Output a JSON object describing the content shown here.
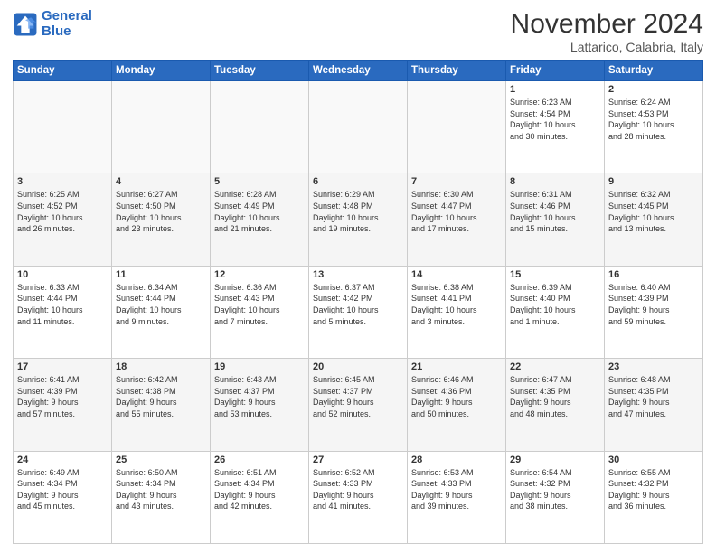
{
  "logo": {
    "line1": "General",
    "line2": "Blue"
  },
  "title": "November 2024",
  "location": "Lattarico, Calabria, Italy",
  "days_header": [
    "Sunday",
    "Monday",
    "Tuesday",
    "Wednesday",
    "Thursday",
    "Friday",
    "Saturday"
  ],
  "weeks": [
    [
      {
        "num": "",
        "info": ""
      },
      {
        "num": "",
        "info": ""
      },
      {
        "num": "",
        "info": ""
      },
      {
        "num": "",
        "info": ""
      },
      {
        "num": "",
        "info": ""
      },
      {
        "num": "1",
        "info": "Sunrise: 6:23 AM\nSunset: 4:54 PM\nDaylight: 10 hours\nand 30 minutes."
      },
      {
        "num": "2",
        "info": "Sunrise: 6:24 AM\nSunset: 4:53 PM\nDaylight: 10 hours\nand 28 minutes."
      }
    ],
    [
      {
        "num": "3",
        "info": "Sunrise: 6:25 AM\nSunset: 4:52 PM\nDaylight: 10 hours\nand 26 minutes."
      },
      {
        "num": "4",
        "info": "Sunrise: 6:27 AM\nSunset: 4:50 PM\nDaylight: 10 hours\nand 23 minutes."
      },
      {
        "num": "5",
        "info": "Sunrise: 6:28 AM\nSunset: 4:49 PM\nDaylight: 10 hours\nand 21 minutes."
      },
      {
        "num": "6",
        "info": "Sunrise: 6:29 AM\nSunset: 4:48 PM\nDaylight: 10 hours\nand 19 minutes."
      },
      {
        "num": "7",
        "info": "Sunrise: 6:30 AM\nSunset: 4:47 PM\nDaylight: 10 hours\nand 17 minutes."
      },
      {
        "num": "8",
        "info": "Sunrise: 6:31 AM\nSunset: 4:46 PM\nDaylight: 10 hours\nand 15 minutes."
      },
      {
        "num": "9",
        "info": "Sunrise: 6:32 AM\nSunset: 4:45 PM\nDaylight: 10 hours\nand 13 minutes."
      }
    ],
    [
      {
        "num": "10",
        "info": "Sunrise: 6:33 AM\nSunset: 4:44 PM\nDaylight: 10 hours\nand 11 minutes."
      },
      {
        "num": "11",
        "info": "Sunrise: 6:34 AM\nSunset: 4:44 PM\nDaylight: 10 hours\nand 9 minutes."
      },
      {
        "num": "12",
        "info": "Sunrise: 6:36 AM\nSunset: 4:43 PM\nDaylight: 10 hours\nand 7 minutes."
      },
      {
        "num": "13",
        "info": "Sunrise: 6:37 AM\nSunset: 4:42 PM\nDaylight: 10 hours\nand 5 minutes."
      },
      {
        "num": "14",
        "info": "Sunrise: 6:38 AM\nSunset: 4:41 PM\nDaylight: 10 hours\nand 3 minutes."
      },
      {
        "num": "15",
        "info": "Sunrise: 6:39 AM\nSunset: 4:40 PM\nDaylight: 10 hours\nand 1 minute."
      },
      {
        "num": "16",
        "info": "Sunrise: 6:40 AM\nSunset: 4:39 PM\nDaylight: 9 hours\nand 59 minutes."
      }
    ],
    [
      {
        "num": "17",
        "info": "Sunrise: 6:41 AM\nSunset: 4:39 PM\nDaylight: 9 hours\nand 57 minutes."
      },
      {
        "num": "18",
        "info": "Sunrise: 6:42 AM\nSunset: 4:38 PM\nDaylight: 9 hours\nand 55 minutes."
      },
      {
        "num": "19",
        "info": "Sunrise: 6:43 AM\nSunset: 4:37 PM\nDaylight: 9 hours\nand 53 minutes."
      },
      {
        "num": "20",
        "info": "Sunrise: 6:45 AM\nSunset: 4:37 PM\nDaylight: 9 hours\nand 52 minutes."
      },
      {
        "num": "21",
        "info": "Sunrise: 6:46 AM\nSunset: 4:36 PM\nDaylight: 9 hours\nand 50 minutes."
      },
      {
        "num": "22",
        "info": "Sunrise: 6:47 AM\nSunset: 4:35 PM\nDaylight: 9 hours\nand 48 minutes."
      },
      {
        "num": "23",
        "info": "Sunrise: 6:48 AM\nSunset: 4:35 PM\nDaylight: 9 hours\nand 47 minutes."
      }
    ],
    [
      {
        "num": "24",
        "info": "Sunrise: 6:49 AM\nSunset: 4:34 PM\nDaylight: 9 hours\nand 45 minutes."
      },
      {
        "num": "25",
        "info": "Sunrise: 6:50 AM\nSunset: 4:34 PM\nDaylight: 9 hours\nand 43 minutes."
      },
      {
        "num": "26",
        "info": "Sunrise: 6:51 AM\nSunset: 4:34 PM\nDaylight: 9 hours\nand 42 minutes."
      },
      {
        "num": "27",
        "info": "Sunrise: 6:52 AM\nSunset: 4:33 PM\nDaylight: 9 hours\nand 41 minutes."
      },
      {
        "num": "28",
        "info": "Sunrise: 6:53 AM\nSunset: 4:33 PM\nDaylight: 9 hours\nand 39 minutes."
      },
      {
        "num": "29",
        "info": "Sunrise: 6:54 AM\nSunset: 4:32 PM\nDaylight: 9 hours\nand 38 minutes."
      },
      {
        "num": "30",
        "info": "Sunrise: 6:55 AM\nSunset: 4:32 PM\nDaylight: 9 hours\nand 36 minutes."
      }
    ]
  ]
}
